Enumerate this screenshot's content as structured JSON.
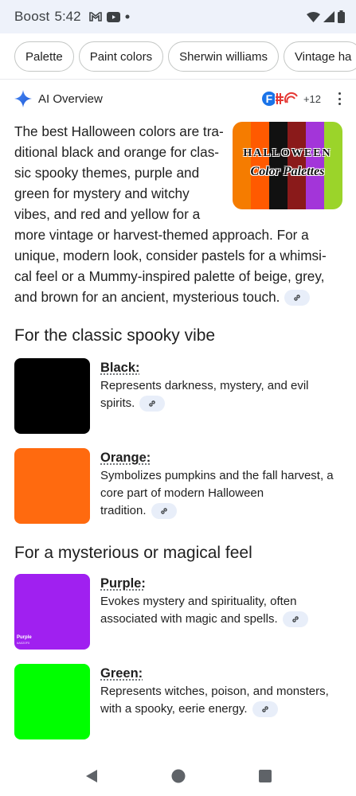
{
  "status_bar": {
    "carrier": "Boost",
    "time": "5:42"
  },
  "chips": [
    "Palette",
    "Paint colors",
    "Sherwin williams",
    "Vintage ha"
  ],
  "ai_overview": {
    "title": "AI Overview",
    "source_count": "+12",
    "thumbnail": {
      "title": "HALLOWEEN",
      "subtitle": "Color Palettes",
      "stripe_colors": [
        "#f57c00",
        "#ff5a00",
        "#111111",
        "#8a1a1a",
        "#a335d9",
        "#9bd42a"
      ]
    },
    "paragraph_lines": [
      "The best Halloween colors are tra-",
      "ditional black and orange for clas-",
      "sic spooky themes, purple and",
      "green for mystery and witchy",
      "vibes, and red and yellow for a",
      "more vintage or harvest-themed approach. For a",
      "unique, modern look, consider pastels for a whimsi-",
      "cal feel or a Mummy-inspired palette of beige, grey,",
      "and brown for an ancient, mysterious touch."
    ]
  },
  "sections": [
    {
      "heading": "For the classic spooky vibe",
      "items": [
        {
          "name": "Black:",
          "color": "#000000",
          "desc_lines": [
            "Represents darkness, mystery, and evil",
            "spirits."
          ]
        },
        {
          "name": "Orange:",
          "color": "#ff6a0f",
          "desc_lines": [
            "Symbolizes pumpkins and the fall harvest, a",
            "core part of modern Halloween",
            "tradition."
          ]
        }
      ]
    },
    {
      "heading": "For a mysterious or magical feel",
      "items": [
        {
          "name": "Purple:",
          "color": "#a020f0",
          "swatch_label": "Purple",
          "swatch_hex": "#A020F0",
          "desc_lines": [
            "Evokes mystery and spirituality, often",
            "associated with magic and spells."
          ]
        },
        {
          "name": "Green:",
          "color": "#00ff00",
          "desc_lines": [
            "Represents witches, poison, and monsters,",
            "with a spooky, eerie energy."
          ]
        }
      ]
    }
  ]
}
